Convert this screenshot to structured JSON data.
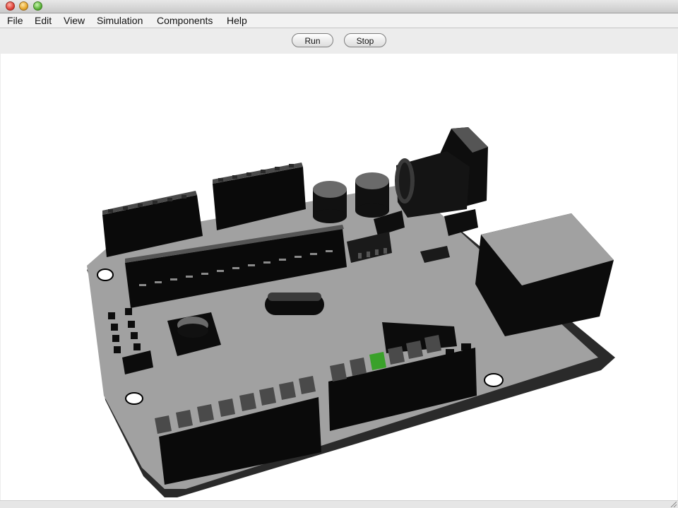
{
  "window": {
    "title": ""
  },
  "menu": [
    "File",
    "Edit",
    "View",
    "Simulation",
    "Components",
    "Help"
  ],
  "toolbar": {
    "run_label": "Run",
    "stop_label": "Stop"
  },
  "scene": {
    "object": "arduino-board-3d-model",
    "colors": {
      "board": "#a1a1a1",
      "components": "#0c0c0c",
      "keys": "#4a4a4a",
      "active_led": "#3aa12a"
    }
  }
}
